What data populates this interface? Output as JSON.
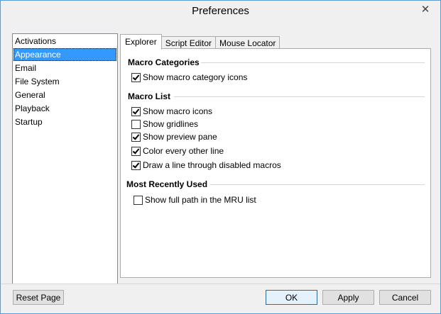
{
  "window": {
    "title": "Preferences",
    "close_glyph": "✕"
  },
  "sidebar": {
    "items": [
      {
        "label": "Activations",
        "selected": false
      },
      {
        "label": "Appearance",
        "selected": true
      },
      {
        "label": "Email",
        "selected": false
      },
      {
        "label": "File System",
        "selected": false
      },
      {
        "label": "General",
        "selected": false
      },
      {
        "label": "Playback",
        "selected": false
      },
      {
        "label": "Startup",
        "selected": false
      }
    ]
  },
  "tabs": [
    {
      "label": "Explorer",
      "active": true
    },
    {
      "label": "Script Editor",
      "active": false
    },
    {
      "label": "Mouse Locator",
      "active": false
    }
  ],
  "groups": {
    "macro_categories": {
      "title": "Macro Categories",
      "options": [
        {
          "label": "Show macro category icons",
          "checked": true
        }
      ]
    },
    "macro_list": {
      "title": "Macro List",
      "options": [
        {
          "label": "Show macro icons",
          "checked": true
        },
        {
          "label": "Show gridlines",
          "checked": false
        },
        {
          "label": "Show preview pane",
          "checked": true
        },
        {
          "label": "Color every other line",
          "checked": true
        },
        {
          "label": "Draw a line through disabled macros",
          "checked": true
        }
      ]
    },
    "mru": {
      "title": "Most Recently Used",
      "options": [
        {
          "label": "Show full path in the MRU list",
          "checked": false
        }
      ]
    }
  },
  "buttons": {
    "reset": "Reset Page",
    "ok": "OK",
    "apply": "Apply",
    "cancel": "Cancel"
  },
  "colors": {
    "selection": "#3399ff",
    "accent_border": "#0078d7"
  }
}
